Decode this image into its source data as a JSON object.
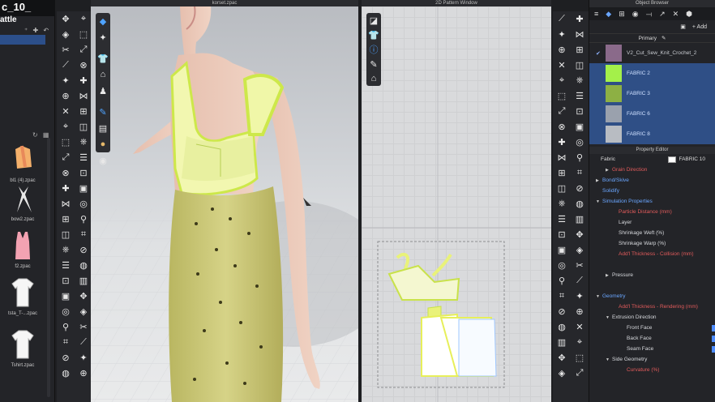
{
  "library": {
    "title": "c_10_",
    "subtitle": "attle",
    "items": [
      {
        "label": "bl1 (4).zpac",
        "icon": "shirt-orange-icon"
      },
      {
        "label": "bow2.zpac",
        "icon": "bow-icon"
      },
      {
        "label": "f2.zpac",
        "icon": "tank-top-pink-icon"
      },
      {
        "label": "tsta_T-...zpac",
        "icon": "tshirt-white-icon"
      },
      {
        "label": "Tshirt.zpac",
        "icon": "tshirt-white-icon"
      }
    ]
  },
  "viewport3d": {
    "title": "korset.zpac"
  },
  "viewport2d": {
    "title": "2D Pattern Window"
  },
  "object_browser": {
    "header": "Object Browser",
    "add_label": "+ Add",
    "primary_label": "Primary",
    "fabrics": [
      {
        "name": "V2_Cut_Sew_Knit_Crochet_2",
        "color": "#8a6a8a",
        "selected": false,
        "checked": true
      },
      {
        "name": "FABRIC 2",
        "color": "#a4f04a",
        "selected": true
      },
      {
        "name": "FABRIC 3",
        "color": "#8db044",
        "selected": true
      },
      {
        "name": "FABRIC 6",
        "color": "#9aa1ad",
        "selected": true
      },
      {
        "name": "FABRIC 8",
        "color": "#b8bcc2",
        "selected": true
      }
    ]
  },
  "property_editor": {
    "header": "Property Editor",
    "fabric_label": "Fabric",
    "fabric_value": "FABRIC 10",
    "rows": [
      {
        "label": "Grain Direction",
        "indent": 1,
        "color": "red",
        "arrow": "▶"
      },
      {
        "label": "Bond/Skive",
        "indent": 0,
        "color": "blue",
        "arrow": "▶"
      },
      {
        "label": "Solidify",
        "indent": 0,
        "color": "blue",
        "arrow": ""
      },
      {
        "label": "Simulation Properties",
        "indent": 0,
        "color": "blue",
        "arrow": "▼"
      },
      {
        "label": "Particle Distance (mm)",
        "indent": 2,
        "color": "red",
        "arrow": ""
      },
      {
        "label": "Layer",
        "indent": 2,
        "color": "white",
        "arrow": ""
      },
      {
        "label": "Shrinkage Weft (%)",
        "indent": 2,
        "color": "white",
        "arrow": ""
      },
      {
        "label": "Shrinkage Warp (%)",
        "indent": 2,
        "color": "white",
        "arrow": ""
      },
      {
        "label": "Add'l Thickness - Collision (mm)",
        "indent": 2,
        "color": "red",
        "arrow": ""
      },
      {
        "label": "",
        "indent": 0,
        "color": "white",
        "arrow": ""
      },
      {
        "label": "Pressure",
        "indent": 1,
        "color": "white",
        "arrow": "▶"
      },
      {
        "label": "",
        "indent": 0,
        "color": "white",
        "arrow": ""
      },
      {
        "label": "Geometry",
        "indent": 0,
        "color": "blue",
        "arrow": "▼"
      },
      {
        "label": "Add'l Thickness - Rendering (mm)",
        "indent": 2,
        "color": "red",
        "arrow": ""
      },
      {
        "label": "Extrusion Direction",
        "indent": 1,
        "color": "white",
        "arrow": "▼"
      },
      {
        "label": "Front Face",
        "indent": 3,
        "color": "white",
        "arrow": ""
      },
      {
        "label": "Back Face",
        "indent": 3,
        "color": "white",
        "arrow": ""
      },
      {
        "label": "Seam Face",
        "indent": 3,
        "color": "white",
        "arrow": ""
      },
      {
        "label": "Side Geometry",
        "indent": 1,
        "color": "white",
        "arrow": "▼"
      },
      {
        "label": "Curvature (%)",
        "indent": 3,
        "color": "red",
        "arrow": ""
      }
    ]
  }
}
